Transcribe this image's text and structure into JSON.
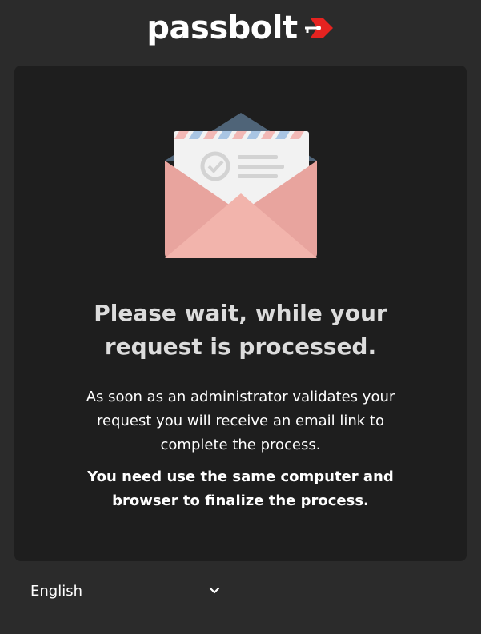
{
  "brand": {
    "name": "passbolt",
    "accent_color": "#e52320"
  },
  "card": {
    "illustration_icon": "open-envelope-icon",
    "title_line1": "Please wait, while your",
    "title_line2": "request is processed.",
    "description_line1": "As soon as an administrator validates your",
    "description_line2": "request you will receive an email link to",
    "description_line3": "complete the process.",
    "note_line1": "You need use the same computer and",
    "note_line2": "browser to finalize the process."
  },
  "footer": {
    "language_selected": "English",
    "language_icon": "chevron-down-icon"
  }
}
